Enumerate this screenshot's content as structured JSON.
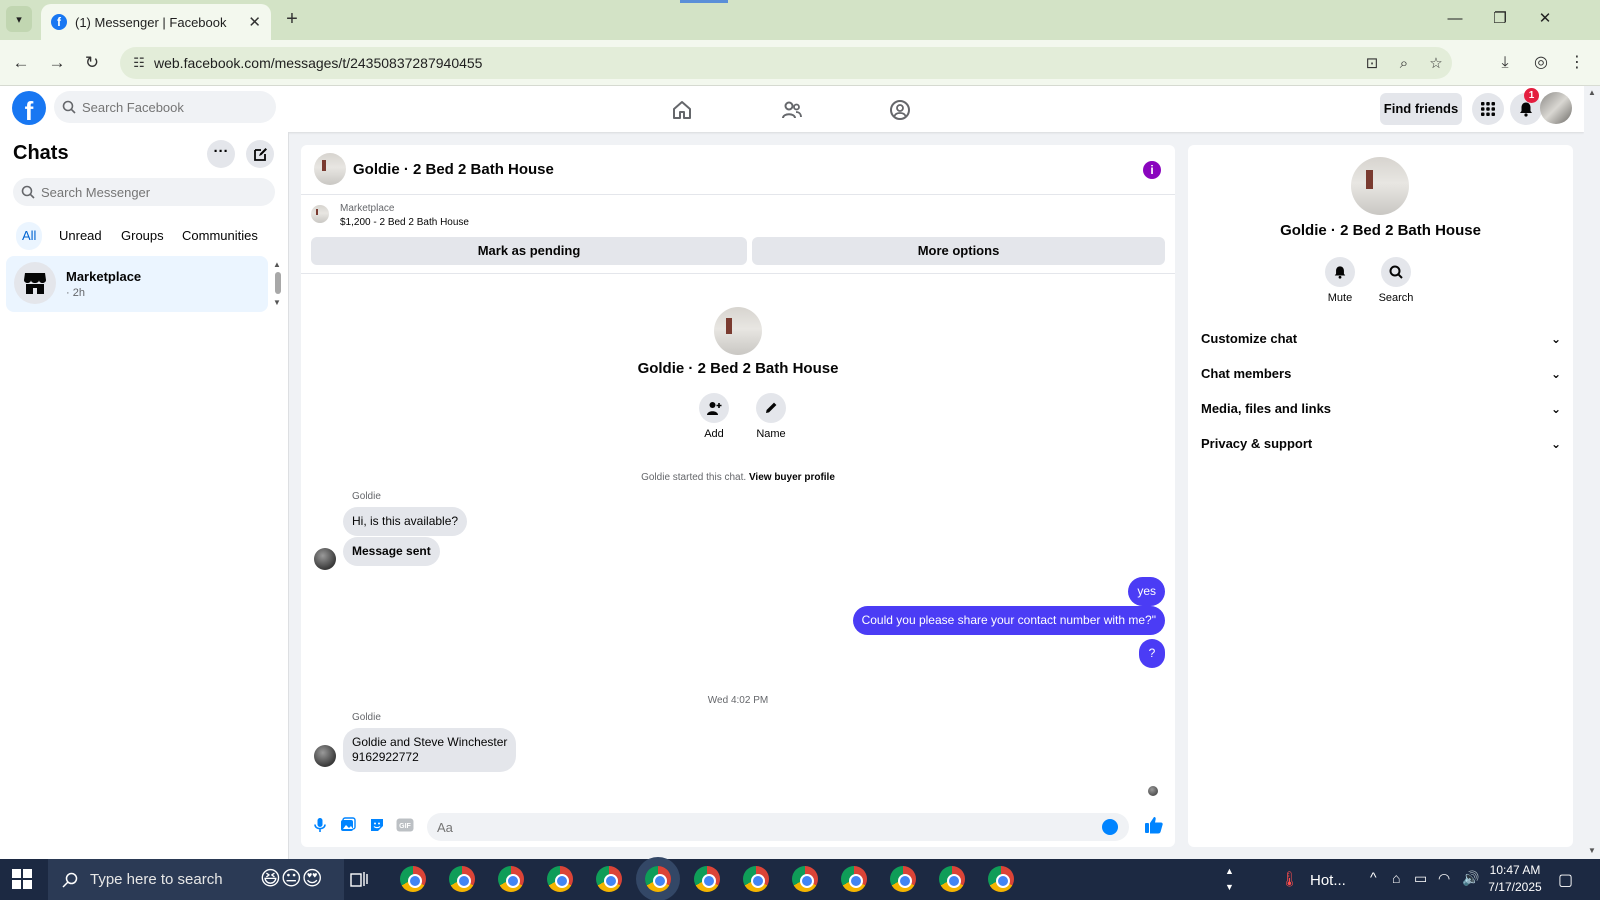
{
  "browser": {
    "tab_title": "(1) Messenger | Facebook",
    "new_tab_label": "+",
    "url": "web.facebook.com/messages/t/24350837287940455"
  },
  "fb": {
    "search_placeholder": "Search Facebook",
    "find_friends": "Find friends",
    "notification_count": "1"
  },
  "chats": {
    "title": "Chats",
    "search_placeholder": "Search Messenger",
    "filters": [
      "All",
      "Unread",
      "Groups",
      "Communities"
    ],
    "items": [
      {
        "name": "Marketplace",
        "time": "· 2h"
      }
    ]
  },
  "conversation": {
    "title": "Goldie · 2 Bed 2 Bath House",
    "listing_source": "Marketplace",
    "listing_title": "$1,200 - 2 Bed 2 Bath House",
    "mark_pending": "Mark as pending",
    "more_options": "More options",
    "actions": [
      {
        "label": "Add",
        "icon": "add-person-icon"
      },
      {
        "label": "Name",
        "icon": "pencil-icon"
      }
    ],
    "started_text": "Goldie started this chat.",
    "buyer_profile_link": "View buyer profile",
    "messages": [
      {
        "sender": "Goldie",
        "text": "Hi, is this available?",
        "direction": "in"
      },
      {
        "text": "Message sent",
        "direction": "in"
      },
      {
        "text": "yes",
        "direction": "out"
      },
      {
        "text": "Could you please share your contact number with me?\"",
        "direction": "out"
      },
      {
        "text": "?",
        "direction": "out"
      },
      {
        "timestamp": "Wed 4:02 PM"
      },
      {
        "sender": "Goldie",
        "text_line1": "Goldie and Steve Winchester",
        "text_line2": "9162922772",
        "direction": "in"
      }
    ],
    "composer_placeholder": "Aa"
  },
  "info_panel": {
    "title": "Goldie · 2 Bed 2 Bath House",
    "actions": [
      {
        "label": "Mute",
        "icon": "bell-icon"
      },
      {
        "label": "Search",
        "icon": "search-icon"
      }
    ],
    "sections": [
      "Customize chat",
      "Chat members",
      "Media, files and links",
      "Privacy & support"
    ]
  },
  "taskbar": {
    "search_placeholder": "Type here to search",
    "weather": "Hot...",
    "time": "10:47 AM",
    "date": "7/17/2025"
  },
  "colors": {
    "fb_blue": "#1877f2",
    "outgoing_bubble": "#4b3cf5",
    "browser_frame": "#d3e3c6"
  }
}
